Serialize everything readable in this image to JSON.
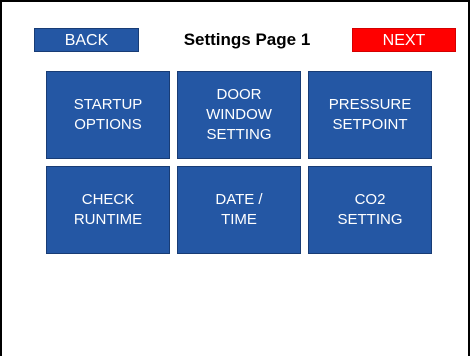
{
  "header": {
    "back_label": "BACK",
    "title": "Settings Page 1",
    "next_label": "NEXT"
  },
  "tiles": [
    {
      "label": "STARTUP\nOPTIONS"
    },
    {
      "label": "DOOR\nWINDOW\nSETTING"
    },
    {
      "label": "PRESSURE\nSETPOINT"
    },
    {
      "label": "CHECK\nRUNTIME"
    },
    {
      "label": "DATE /\nTIME"
    },
    {
      "label": "CO2\nSETTING"
    }
  ],
  "colors": {
    "button_blue": "#2457a4",
    "next_red": "#ff0000",
    "frame_black": "#000000",
    "background": "#ffffff"
  }
}
